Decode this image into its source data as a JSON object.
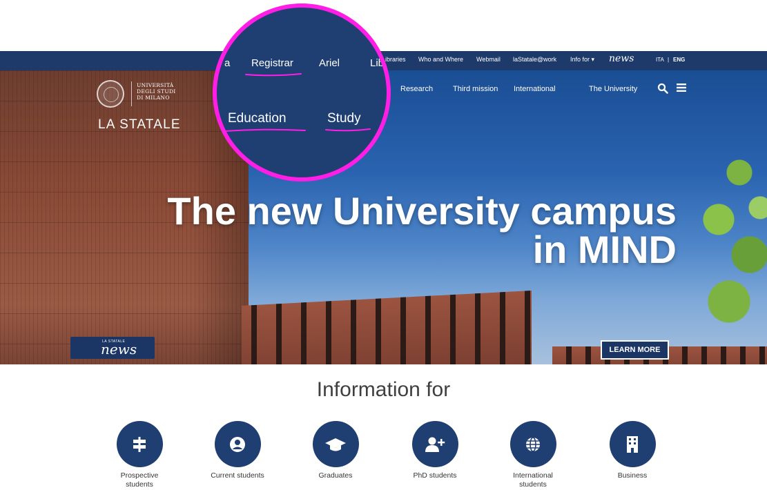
{
  "topbar": {
    "links": [
      "Libraries",
      "Who and Where",
      "Webmail",
      "laStatale@work",
      "Info for ▾"
    ],
    "news_logo": "news",
    "lang_ita": "ITA",
    "lang_sep": "|",
    "lang_eng": "ENG"
  },
  "brand": {
    "line1": "UNIVERSITÀ",
    "line2": "DEGLI STUDI",
    "line3": "DI MILANO",
    "name": "LA STATALE"
  },
  "mainnav": {
    "research": "Research",
    "third_mission": "Third mission",
    "international": "International",
    "university": "The University"
  },
  "magnifier": {
    "a": "a",
    "registrar": "Registrar",
    "ariel": "Ariel",
    "lib": "Lib",
    "education": "Education",
    "study": "Study"
  },
  "hero": {
    "headline_line1": "The new University campus",
    "headline_line2": "in MIND",
    "news_badge_small": "LA STATALE",
    "news_badge_big": "news",
    "learn_more": "LEARN MORE"
  },
  "info": {
    "title": "Information for",
    "categories": [
      {
        "label": "Prospective students",
        "icon": "signpost-icon"
      },
      {
        "label": "Current students",
        "icon": "user-icon"
      },
      {
        "label": "Graduates",
        "icon": "graduation-cap-icon"
      },
      {
        "label": "PhD students",
        "icon": "user-plus-icon"
      },
      {
        "label": "International students",
        "icon": "globe-icon"
      },
      {
        "label": "Business",
        "icon": "building-icon"
      }
    ]
  },
  "colors": {
    "navy": "#1f3e72",
    "highlight": "#ff1ee6"
  }
}
